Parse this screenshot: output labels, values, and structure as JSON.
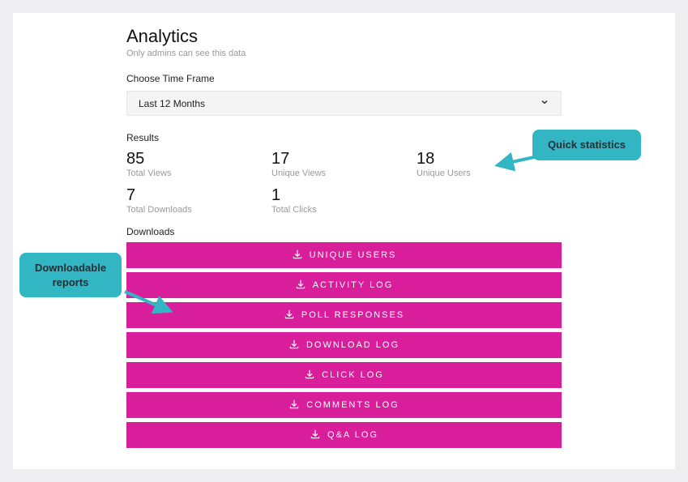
{
  "page": {
    "title": "Analytics",
    "subtitle": "Only admins can see this data"
  },
  "timeframe": {
    "label": "Choose Time Frame",
    "selected": "Last 12 Months"
  },
  "results": {
    "label": "Results",
    "stats": [
      {
        "value": "85",
        "label": "Total Views"
      },
      {
        "value": "17",
        "label": "Unique Views"
      },
      {
        "value": "18",
        "label": "Unique Users"
      },
      {
        "value": "7",
        "label": "Total Downloads"
      },
      {
        "value": "1",
        "label": "Total Clicks"
      }
    ]
  },
  "downloads": {
    "label": "Downloads",
    "buttons": [
      "UNIQUE USERS",
      "ACTIVITY LOG",
      "POLL RESPONSES",
      "DOWNLOAD LOG",
      "CLICK LOG",
      "COMMENTS LOG",
      "Q&A LOG"
    ]
  },
  "callouts": {
    "right": "Quick statistics",
    "left": "Downloadable reports"
  }
}
